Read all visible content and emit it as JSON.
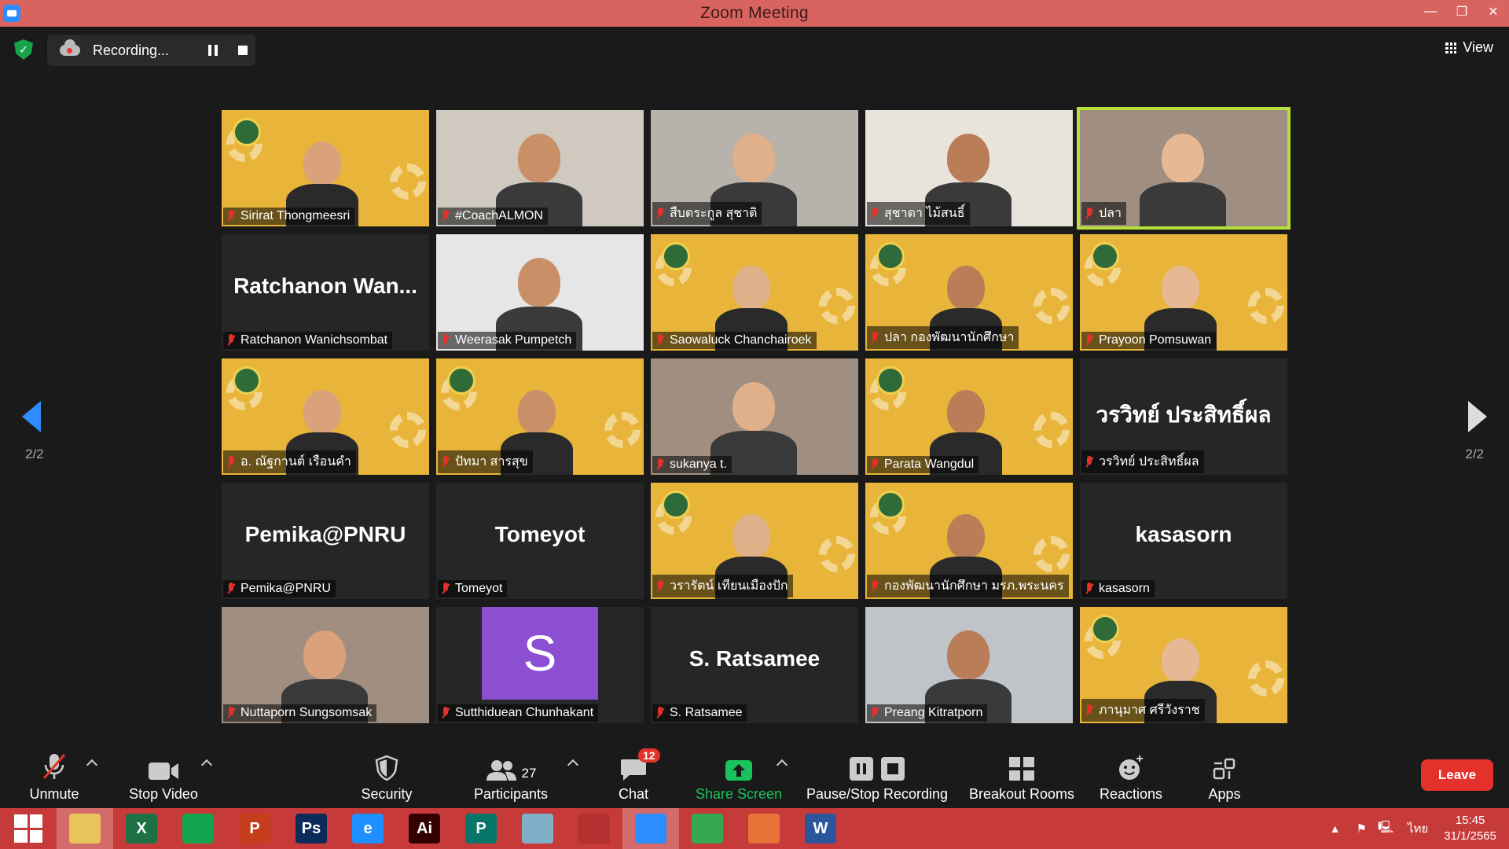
{
  "window": {
    "title": "Zoom Meeting",
    "min": "—",
    "max": "❐",
    "close": "✕"
  },
  "topbar": {
    "recording_label": "Recording...",
    "view_label": "View"
  },
  "gallery": {
    "page_indicator": "2/2",
    "tiles": [
      {
        "name": "Sirirat Thongmeesri",
        "kind": "yellow",
        "active": false
      },
      {
        "name": "#CoachALMON",
        "kind": "photo",
        "active": false
      },
      {
        "name": "สืบตระกูล สุชาติ",
        "kind": "photo",
        "active": false
      },
      {
        "name": "สุชาดา ไม้สนธิ์",
        "kind": "photo",
        "active": false
      },
      {
        "name": "ปลา",
        "kind": "photo",
        "active": true
      },
      {
        "name": "Ratchanon Wanichsombat",
        "kind": "name",
        "display": "Ratchanon  Wan...",
        "active": false
      },
      {
        "name": "Weerasak Pumpetch",
        "kind": "photo",
        "active": false
      },
      {
        "name": "Saowaluck Chanchairoek",
        "kind": "yellow",
        "active": false
      },
      {
        "name": "ปลา กองพัฒนานักศึกษา",
        "kind": "yellow",
        "active": false
      },
      {
        "name": "Prayoon Pomsuwan",
        "kind": "yellow",
        "active": false
      },
      {
        "name": "อ. ณัฐกานต์ เรือนคำ",
        "kind": "yellow",
        "active": false
      },
      {
        "name": "ปัทมา สารสุข",
        "kind": "yellow",
        "active": false
      },
      {
        "name": "sukanya t.",
        "kind": "photo",
        "active": false
      },
      {
        "name": "Parata Wangdul",
        "kind": "yellow",
        "active": false
      },
      {
        "name": "วรวิทย์ ประสิทธิ์ผล",
        "kind": "name",
        "display": "วรวิทย์ ประสิทธิ์ผล",
        "active": false
      },
      {
        "name": "Pemika@PNRU",
        "kind": "name",
        "display": "Pemika@PNRU",
        "active": false
      },
      {
        "name": "Tomeyot",
        "kind": "name",
        "display": "Tomeyot",
        "active": false
      },
      {
        "name": "วรารัตน์ เทียนเมืองปัก",
        "kind": "yellow",
        "active": false
      },
      {
        "name": "กองพัฒนานักศึกษา มรภ.พระนคร",
        "kind": "yellow",
        "active": false
      },
      {
        "name": "kasasorn",
        "kind": "name",
        "display": "kasasorn",
        "active": false
      },
      {
        "name": "Nuttaporn Sungsomsak",
        "kind": "photo",
        "active": false
      },
      {
        "name": "Sutthiduean Chunhakant",
        "kind": "avatar",
        "initial": "S",
        "active": false
      },
      {
        "name": "S. Ratsamee",
        "kind": "name",
        "display": "S. Ratsamee",
        "active": false
      },
      {
        "name": "Preang Kitratporn",
        "kind": "photo",
        "active": false
      },
      {
        "name": "ภานุมาศ ศรีวังราช",
        "kind": "yellow",
        "active": false
      }
    ]
  },
  "controls": {
    "unmute": "Unmute",
    "stop_video": "Stop Video",
    "security": "Security",
    "participants": "Participants",
    "participants_count": "27",
    "chat": "Chat",
    "chat_badge": "12",
    "share_screen": "Share Screen",
    "pause_stop_recording": "Pause/Stop Recording",
    "breakout_rooms": "Breakout Rooms",
    "reactions": "Reactions",
    "apps": "Apps",
    "leave": "Leave"
  },
  "taskbar": {
    "apps": [
      {
        "icon": "windows-start-icon",
        "glyph": "",
        "color": "#ffffff"
      },
      {
        "icon": "file-explorer-icon",
        "glyph": "",
        "color": "#e8c55a"
      },
      {
        "icon": "excel-icon",
        "glyph": "X",
        "color": "#1e7145"
      },
      {
        "icon": "store-icon",
        "glyph": "",
        "color": "#14a44d"
      },
      {
        "icon": "powerpoint-icon",
        "glyph": "P",
        "color": "#c43e1c"
      },
      {
        "icon": "photoshop-icon",
        "glyph": "Ps",
        "color": "#0b2b59"
      },
      {
        "icon": "internet-explorer-icon",
        "glyph": "e",
        "color": "#1e90ff"
      },
      {
        "icon": "illustrator-icon",
        "glyph": "Ai",
        "color": "#330000"
      },
      {
        "icon": "publisher-icon",
        "glyph": "P",
        "color": "#077568"
      },
      {
        "icon": "notepad-icon",
        "glyph": "",
        "color": "#7fb0c8"
      },
      {
        "icon": "hotocape-icon",
        "glyph": "",
        "color": "#b53030"
      },
      {
        "icon": "zoom-icon",
        "glyph": "",
        "color": "#2d8cff"
      },
      {
        "icon": "chrome-icon",
        "glyph": "",
        "color": "#34a853"
      },
      {
        "icon": "office-icon",
        "glyph": "",
        "color": "#e9743a"
      },
      {
        "icon": "word-icon",
        "glyph": "W",
        "color": "#2b579a"
      }
    ],
    "language": "ไทย",
    "time": "15:45",
    "date": "31/1/2565"
  },
  "colors": {
    "titlebar": "#d9645f",
    "taskbar": "#c63a3a",
    "accent": "#2d8cff",
    "active_speaker": "#b6e03a",
    "leave": "#e4312b"
  }
}
